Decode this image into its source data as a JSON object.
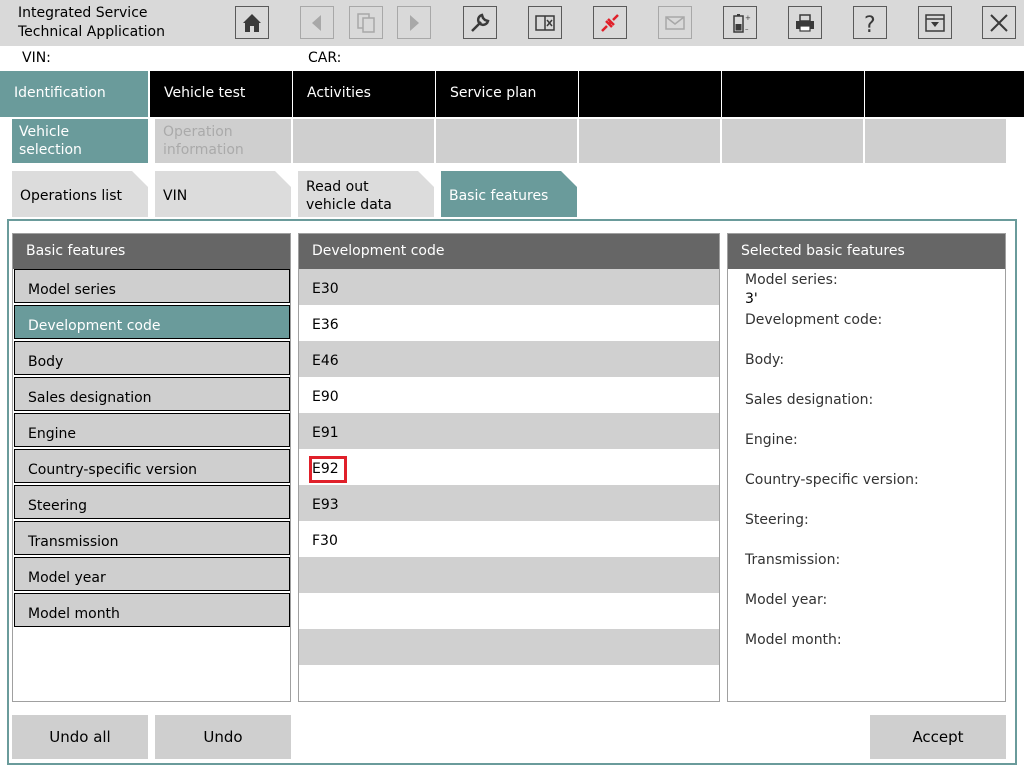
{
  "app": {
    "title": "Integrated Service\nTechnical Application"
  },
  "toolbar": {
    "buttons": [
      {
        "name": "home",
        "icon": "home-icon",
        "enabled": true
      },
      {
        "name": "back",
        "icon": "arrow-left-icon",
        "enabled": false
      },
      {
        "name": "copy",
        "icon": "documents-icon",
        "enabled": false
      },
      {
        "name": "forward",
        "icon": "arrow-right-icon",
        "enabled": false
      },
      {
        "name": "wrench",
        "icon": "wrench-icon",
        "enabled": true
      },
      {
        "name": "display",
        "icon": "split-window-icon",
        "enabled": true
      },
      {
        "name": "connection",
        "icon": "plug-disconnected-icon",
        "enabled": true,
        "color": "#e0202a"
      },
      {
        "name": "mail",
        "icon": "envelope-icon",
        "enabled": false
      },
      {
        "name": "battery",
        "icon": "battery-icon",
        "enabled": true
      },
      {
        "name": "print",
        "icon": "printer-icon",
        "enabled": true
      },
      {
        "name": "help",
        "icon": "question-icon",
        "enabled": true
      },
      {
        "name": "minimize",
        "icon": "window-minimize-icon",
        "enabled": true
      },
      {
        "name": "close",
        "icon": "close-icon",
        "enabled": true
      }
    ]
  },
  "info": {
    "vin_label": "VIN:",
    "car_label": "CAR:"
  },
  "main_nav": [
    {
      "label": "Identification",
      "active": true
    },
    {
      "label": "Vehicle test",
      "active": false
    },
    {
      "label": "Activities",
      "active": false
    },
    {
      "label": "Service plan",
      "active": false
    },
    {
      "label": "",
      "active": false
    },
    {
      "label": "",
      "active": false
    },
    {
      "label": "",
      "active": false
    }
  ],
  "sub_nav": [
    {
      "label": "Vehicle\nselection",
      "active": true
    },
    {
      "label": "Operation\ninformation",
      "active": false
    }
  ],
  "tabs": [
    {
      "label": "Operations list",
      "active": false
    },
    {
      "label": "VIN",
      "active": false
    },
    {
      "label": "Read out\nvehicle data",
      "active": false
    },
    {
      "label": "Basic features",
      "active": true
    }
  ],
  "basic_features": {
    "header": "Basic features",
    "items": [
      "Model series",
      "Development code",
      "Body",
      "Sales designation",
      "Engine",
      "Country-specific version",
      "Steering",
      "Transmission",
      "Model year",
      "Model month"
    ],
    "active_index": 1
  },
  "development_code": {
    "header": "Development code",
    "codes": [
      "E30",
      "E36",
      "E46",
      "E90",
      "E91",
      "E92",
      "E93",
      "F30"
    ],
    "highlighted": "E92"
  },
  "selected_features": {
    "header": "Selected basic features",
    "labels": {
      "model_series": "Model series:",
      "model_series_value": "3'",
      "development_code": "Development code:",
      "body": "Body:",
      "sales_designation": "Sales designation:",
      "engine": "Engine:",
      "country": "Country-specific version:",
      "steering": "Steering:",
      "transmission": "Transmission:",
      "model_year": "Model year:",
      "model_month": "Model month:"
    }
  },
  "buttons": {
    "undo_all": "Undo all",
    "undo": "Undo",
    "accept": "Accept"
  }
}
